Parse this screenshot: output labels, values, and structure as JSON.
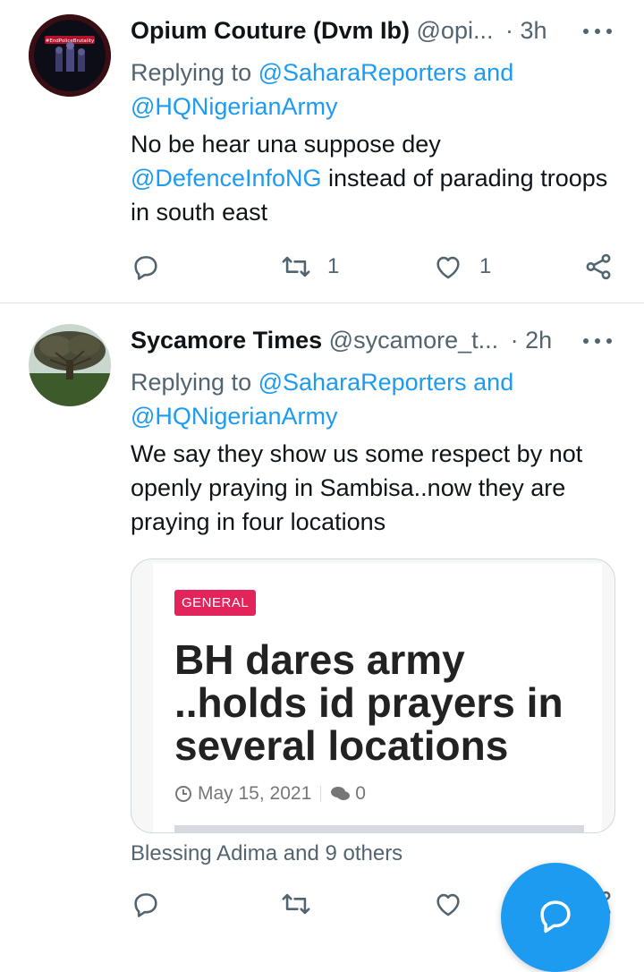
{
  "tweets": [
    {
      "name": "Opium Couture (Dvm Ib)",
      "handle": "@opi...",
      "time": "· 3h",
      "replying_prefix": "Replying to",
      "replying_to_1": "@SaharaReporters",
      "replying_and": "and",
      "replying_to_2": "@HQNigerianArmy",
      "text_part1": "No be hear una suppose dey",
      "text_mention": "@DefenceInfoNG",
      "text_part2": "instead of parading troops in south east",
      "retweet_count": "1",
      "like_count": "1",
      "avatar_text": "#EndPoliceBrutality"
    },
    {
      "name": "Sycamore Times",
      "handle": "@sycamore_t...",
      "time": "· 2h",
      "replying_prefix": "Replying to",
      "replying_to_1": "@SaharaReporters",
      "replying_and": "and",
      "replying_to_2": "@HQNigerianArmy",
      "text": "We say they show us some respect by not openly praying in Sambisa..now they are praying in four locations",
      "card": {
        "badge": "GENERAL",
        "headline": "BH dares army ..holds id prayers in several locations",
        "date": "May 15, 2021",
        "comments": "0"
      },
      "liked_by": "Blessing Adima and 9 others"
    }
  ],
  "colors": {
    "accent": "#1d9bf0",
    "badge": "#e3245a",
    "secondary_text": "#536471"
  },
  "icons": [
    "reply-icon",
    "retweet-icon",
    "like-icon",
    "share-icon",
    "more-icon",
    "compose-reply-icon",
    "clock-icon",
    "comments-icon"
  ]
}
